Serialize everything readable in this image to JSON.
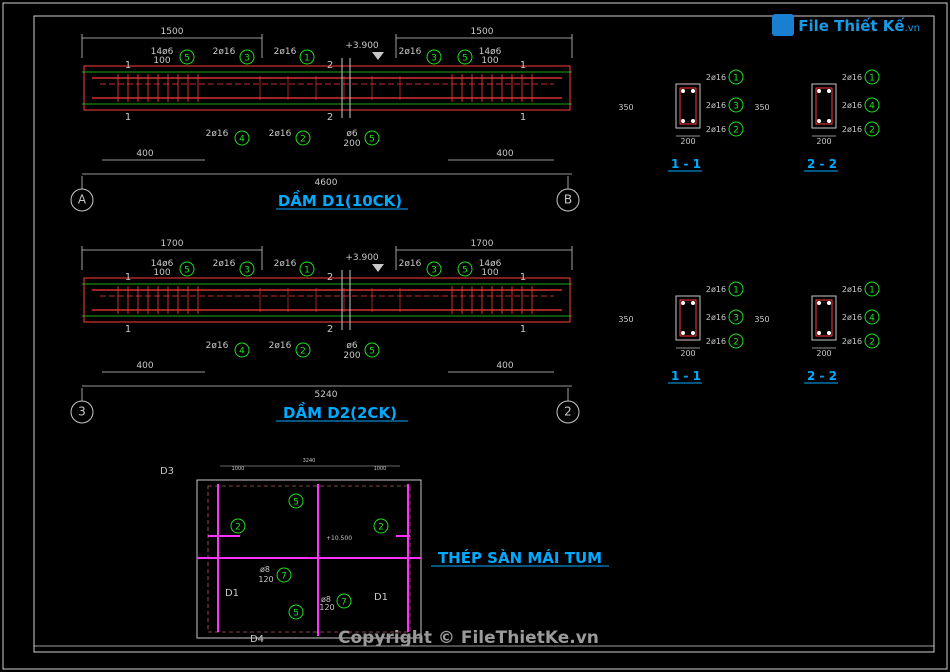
{
  "colors": {
    "frame": "#d0d0d0",
    "beam": "#ff3b3b",
    "steel": "#ff3b3b",
    "dim": "#c8c8c8",
    "green": "#1fe01f",
    "cyan": "#40e0e0",
    "magenta": "#ff33ff",
    "title": "#00aaff"
  },
  "logo": {
    "brand": "File Thiết Kế",
    "domain": ".vn"
  },
  "copyright": "Copyright © FileThietKe.vn",
  "beam1": {
    "title": "DẦM D1(10CK)",
    "dim_left": "1500",
    "dim_right": "1500",
    "dim_total": "4600",
    "dim_bl": "400",
    "dim_br": "400",
    "elev": "+3.900",
    "axis_left": "A",
    "axis_right": "B",
    "l_stirrup": "14ø6",
    "l_stirrup_sp": "100",
    "r_stirrup": "14ø6",
    "r_stirrup_sp": "100",
    "bar3": "2ø16",
    "bar1": "2ø16",
    "bar4": "2ø16",
    "bar2": "2ø16",
    "mid_stirrup": "ø6",
    "mid_sp": "200",
    "sec_l": "1",
    "sec_r": "2"
  },
  "beam2": {
    "title": "DẦM D2(2CK)",
    "dim_left": "1700",
    "dim_right": "1700",
    "dim_total": "5240",
    "dim_bl": "400",
    "dim_br": "400",
    "elev": "+3.900",
    "axis_left": "3",
    "axis_right": "2",
    "l_stirrup": "14ø6",
    "l_stirrup_sp": "100",
    "r_stirrup": "14ø6",
    "r_stirrup_sp": "100",
    "bar3": "2ø16",
    "bar1": "2ø16",
    "bar4": "2ø16",
    "bar2": "2ø16",
    "mid_stirrup": "ø6",
    "mid_sp": "200",
    "sec_l": "1",
    "sec_r": "2"
  },
  "sections": {
    "h": "350",
    "h2": "350",
    "b": "200",
    "top": "2ø16",
    "mid": "2ø16",
    "bot": "2ø16",
    "n1": "1",
    "n3": "3",
    "n4": "4",
    "n2": "2",
    "n5": "5",
    "label1": "1 - 1",
    "label2": "2 - 2"
  },
  "slab": {
    "title": "THÉP SÀN MÁI TUM",
    "d1": "D1",
    "d3": "D3",
    "d4": "D4",
    "bar": "ø8",
    "sp": "120",
    "elev": "+10.500",
    "dim_small": "1000",
    "dim_mid": "3240",
    "n2": "2",
    "n5": "5",
    "n7": "7"
  }
}
